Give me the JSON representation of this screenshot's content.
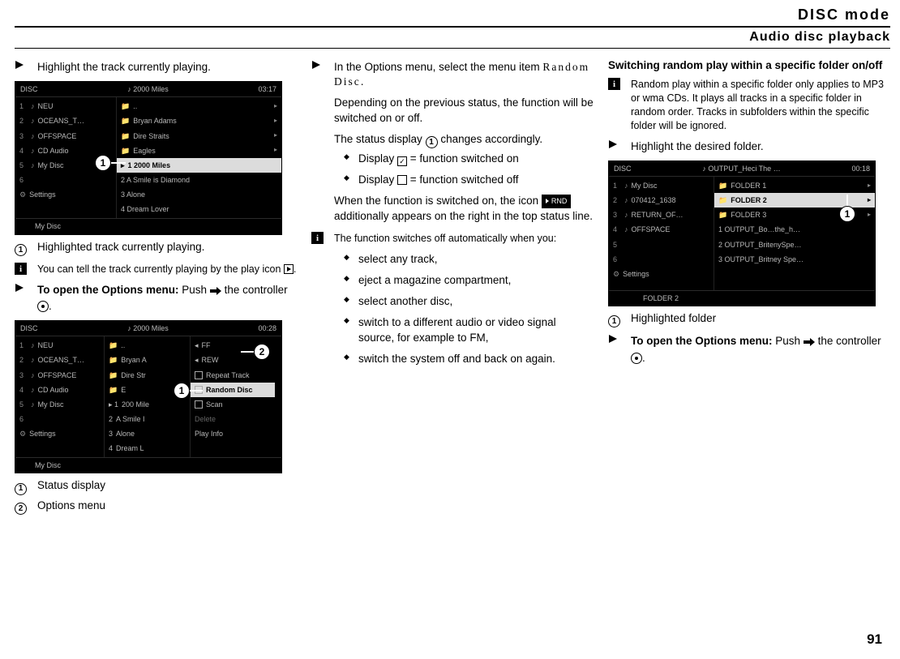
{
  "header": {
    "mode": "DISC mode",
    "sub": "Audio disc playback"
  },
  "page_number": "91",
  "col1": {
    "step1": "Highlight the track currently playing.",
    "shot1": {
      "top_left": "DISC",
      "top_mid": "2000 Miles",
      "top_right": "03:17",
      "left": [
        "NEU",
        "OCEANS_T…",
        "OFFSPACE",
        "CD Audio",
        "My Disc"
      ],
      "left_settings": "Settings",
      "right_top": [
        "..",
        "Bryan Adams",
        "Dire Straits",
        "Eagles"
      ],
      "right_hilite": "1   2000 Miles",
      "right_after": [
        "2   A Smile is Diamond",
        "3   Alone",
        "4   Dream Lover"
      ],
      "bottom": [
        "",
        "My Disc"
      ]
    },
    "cap1": "Highlighted track currently playing.",
    "info1": "You can tell the track currently playing by the play icon",
    "step2_a": "To open the Options menu:",
    "step2_b": "Push",
    "step2_c": "the controller",
    "shot2": {
      "top_left": "DISC",
      "top_mid": "2000 Miles",
      "top_right": "00:28",
      "left": [
        "NEU",
        "OCEANS_T…",
        "OFFSPACE",
        "CD Audio",
        "My Disc"
      ],
      "left_settings": "Settings",
      "mid_top": [
        "..",
        "Bryan A",
        "Dire Str",
        "E"
      ],
      "mid_after": [
        "200 Mile",
        "A Smile I",
        "Alone",
        "Dream L"
      ],
      "opt": [
        "FF",
        "REW",
        "Repeat Track"
      ],
      "opt_hilite": "Random Disc",
      "opt_after": [
        "Scan"
      ],
      "opt_dim": "Delete",
      "opt_last": "Play Info",
      "bottom": [
        "",
        "My Disc"
      ]
    },
    "cap2a": "Status display",
    "cap2b": "Options menu"
  },
  "col2": {
    "step1_a": "In the Options menu, select the menu item",
    "step1_b": "Random Disc",
    "para1": "Depending on the previous status, the function will be switched on or off.",
    "para2_a": "The status display",
    "para2_b": "changes accordingly.",
    "b1_a": "Display",
    "b1_b": "= function switched on",
    "b2_a": "Display",
    "b2_b": "= function switched off",
    "para3_a": "When the function is switched on, the icon",
    "para3_b": "additionally appears on the right in the top status line.",
    "info1": "The function switches off automatically when you:",
    "bullets": [
      "select any track,",
      "eject a magazine compartment,",
      "select another disc,",
      "switch to a different audio or video signal source, for example to FM,",
      "switch the system off and back on again."
    ]
  },
  "col3": {
    "subhead": "Switching random play within a specific folder on/off",
    "info1": "Random play within a specific folder only applies to MP3 or wma CDs. It plays all tracks in a specific folder in random order. Tracks in subfolders within the specific folder will be ignored.",
    "step1": "Highlight the desired folder.",
    "shot1": {
      "top_left": "DISC",
      "top_mid": "OUTPUT_Heci The …",
      "top_right": "00:18",
      "left": [
        "My Disc",
        "070412_1638",
        "RETURN_OF…",
        "OFFSPACE"
      ],
      "left_settings": "Settings",
      "right_top": [
        "FOLDER 1"
      ],
      "right_hilite": "FOLDER 2",
      "right_after": [
        "FOLDER 3",
        "1   OUTPUT_Bo…the_h…",
        "2   OUTPUT_BritenySpe…",
        "3   OUTPUT_Britney Spe…"
      ],
      "bottom": [
        "",
        "",
        "FOLDER 2"
      ]
    },
    "cap1": "Highlighted folder",
    "step2_a": "To open the Options menu:",
    "step2_b": "Push",
    "step2_c": "the controller"
  }
}
